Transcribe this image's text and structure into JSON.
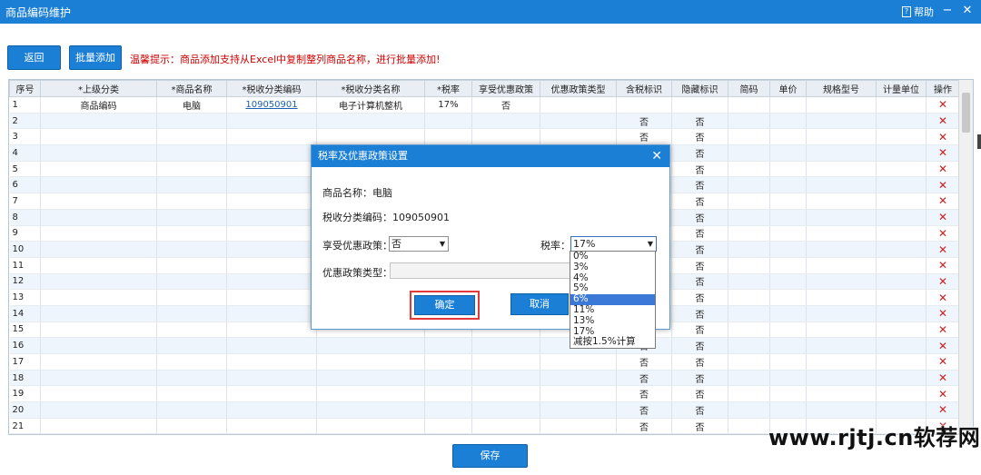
{
  "window": {
    "title": "商品编码维护",
    "help_label": "帮助",
    "minimize_glyph": "−",
    "close_glyph": "✕"
  },
  "toolbar": {
    "back_label": "返回",
    "batch_add_label": "批量添加",
    "tip": "温馨提示：商品添加支持从Excel中复制整列商品名称，进行批量添加!"
  },
  "grid": {
    "columns": [
      "序号",
      "*上级分类",
      "*商品名称",
      "*税收分类编码",
      "*税收分类名称",
      "*税率",
      "享受优惠政策",
      "优惠政策类型",
      "含税标识",
      "隐藏标识",
      "简码",
      "单价",
      "规格型号",
      "计量单位",
      "操作"
    ],
    "first_row": {
      "seq": "1",
      "parent_category": "商品编码",
      "name": "电脑",
      "tax_code": "109050901",
      "tax_name": "电子计算机整机",
      "tax_rate": "17%",
      "preferential": "否"
    },
    "row_numbers": [
      "2",
      "3",
      "4",
      "5",
      "6",
      "7",
      "8",
      "9",
      "10",
      "11",
      "12",
      "13",
      "14",
      "15",
      "16",
      "17",
      "18",
      "19",
      "20",
      "21"
    ],
    "no_value": "否",
    "delete_glyph": "✕"
  },
  "dialog": {
    "title": "税率及优惠政策设置",
    "close_glyph": "✕",
    "product_name_label": "商品名称：",
    "product_name": "电脑",
    "tax_code_label": "税收分类编码：",
    "tax_code": "109050901",
    "preferential_label": "享受优惠政策：",
    "preferential_value": "否",
    "tax_rate_label": "税率：",
    "tax_rate_value": "17%",
    "policy_type_label": "优惠政策类型：",
    "ok_label": "确定",
    "cancel_label": "取消"
  },
  "tax_rate_options": [
    "0%",
    "3%",
    "4%",
    "5%",
    "6%",
    "11%",
    "13%",
    "17%",
    "减按1.5%计算"
  ],
  "tax_rate_highlighted_index": 4,
  "save_label": "保存",
  "watermark": "www.rjtj.cn软荐网",
  "colors": {
    "accent": "#1c7fd6",
    "tip": "#cc0000",
    "delete": "#d21f1f",
    "highlight": "#3a79d8",
    "ok_frame": "#e23a3a"
  }
}
